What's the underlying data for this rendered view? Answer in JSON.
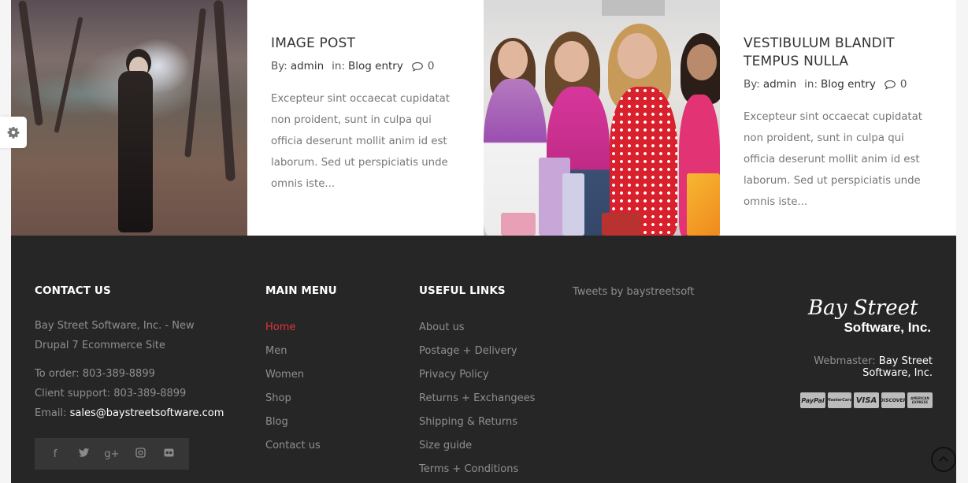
{
  "posts": [
    {
      "title": "IMAGE POST",
      "by_label": "By:",
      "author": "admin",
      "in_label": "in:",
      "category": "Blog entry",
      "comments": "0",
      "excerpt": "Excepteur sint occaecat cupidatat non proident, sunt in culpa qui officia deserunt mollit anim id est laborum. Sed ut perspiciatis unde omnis iste..."
    },
    {
      "title": "VESTIBULUM BLANDIT TEMPUS NULLA",
      "by_label": "By:",
      "author": "admin",
      "in_label": "in:",
      "category": "Blog entry",
      "comments": "0",
      "excerpt": "Excepteur sint occaecat cupidatat non proident, sunt in culpa qui officia deserunt mollit anim id est laborum. Sed ut perspiciatis unde omnis iste..."
    }
  ],
  "footer": {
    "contact": {
      "heading": "CONTACT US",
      "company": "Bay Street Software, Inc. - New Drupal 7 Ecommerce Site",
      "order": "To order: 803-389-8899",
      "support": "Client support: 803-389-8899",
      "email_label": "Email:",
      "email": "sales@baystreetsoftware.com",
      "social_icons": [
        "facebook-icon",
        "twitter-icon",
        "google-plus-icon",
        "instagram-icon",
        "flickr-icon"
      ]
    },
    "main_menu": {
      "heading": "MAIN MENU",
      "items": [
        "Home",
        "Men",
        "Women",
        "Shop",
        "Blog",
        "Contact us"
      ]
    },
    "useful_links": {
      "heading": "USEFUL LINKS",
      "items": [
        "About us",
        "Postage + Delivery",
        "Privacy Policy",
        "Returns + Exchangees",
        "Shipping & Returns",
        "Size guide",
        "Terms + Conditions"
      ]
    },
    "tweets": "Tweets by baystreetsoft",
    "brand": {
      "logo_line1": "Bay Street",
      "logo_line2": "Software, Inc.",
      "webmaster_label": "Webmaster:",
      "webmaster_name": "Bay Street Software, Inc.",
      "payments": [
        "PayPal",
        "MasterCard",
        "VISA",
        "DISCOVER",
        "AMERICAN EXPRESS"
      ]
    }
  },
  "colors": {
    "footer_bg": "#262626",
    "active_link": "#e3333a",
    "page_bg": "#f5f5f5"
  }
}
